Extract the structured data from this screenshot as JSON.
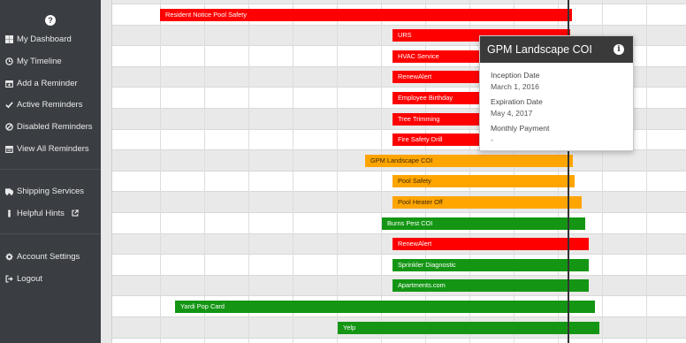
{
  "sidebar": {
    "help_icon": "?",
    "items": [
      {
        "label": "My Dashboard",
        "icon": "dashboard-icon"
      },
      {
        "label": "My Timeline",
        "icon": "clock-icon"
      },
      {
        "label": "Add a Reminder",
        "icon": "calendar-plus-icon"
      },
      {
        "label": "Active Reminders",
        "icon": "check-icon"
      },
      {
        "label": "Disabled Reminders",
        "icon": "ban-icon"
      },
      {
        "label": "View All Reminders",
        "icon": "calendar-icon"
      },
      {
        "label": "Shipping Services",
        "icon": "truck-icon"
      },
      {
        "label": "Helpful Hints",
        "icon": "info-icon",
        "external": "external-link-icon"
      },
      {
        "label": "Account Settings",
        "icon": "gear-icon"
      },
      {
        "label": "Logout",
        "icon": "sign-out-icon"
      }
    ]
  },
  "colors": {
    "red": "#ff0000",
    "orange": "#ffa500",
    "green": "#149614",
    "sidebar_bg": "#3a3d42",
    "popover_header": "#3a3a3a"
  },
  "timeline": {
    "bars": [
      {
        "label": "Resident Notice Pool Safety",
        "status": "red"
      },
      {
        "label": "URS",
        "status": "red"
      },
      {
        "label": "HVAC Service",
        "status": "red"
      },
      {
        "label": "RenewAlert",
        "status": "red"
      },
      {
        "label": "Employee Birthday",
        "status": "red"
      },
      {
        "label": "Tree Trimming",
        "status": "red"
      },
      {
        "label": "Fire Safety Drill",
        "status": "red"
      },
      {
        "label": "GPM Landscape COI",
        "status": "orange"
      },
      {
        "label": "Pool Safety",
        "status": "orange"
      },
      {
        "label": "Pool Heater Off",
        "status": "orange"
      },
      {
        "label": "Burns Pest COI",
        "status": "green"
      },
      {
        "label": "RenewAlert",
        "status": "red"
      },
      {
        "label": "Sprinkler Diagnostic",
        "status": "green"
      },
      {
        "label": "Apartments.com",
        "status": "green"
      },
      {
        "label": "Yardi Pop Card",
        "status": "green"
      },
      {
        "label": "Yelp",
        "status": "green"
      }
    ]
  },
  "popover": {
    "title": "GPM Landscape COI",
    "info_icon": "i",
    "fields": [
      {
        "label": "Inception Date",
        "value": "March 1, 2016"
      },
      {
        "label": "Expiration Date",
        "value": "May 4, 2017"
      },
      {
        "label": "Monthly Payment",
        "value": "-"
      }
    ]
  }
}
